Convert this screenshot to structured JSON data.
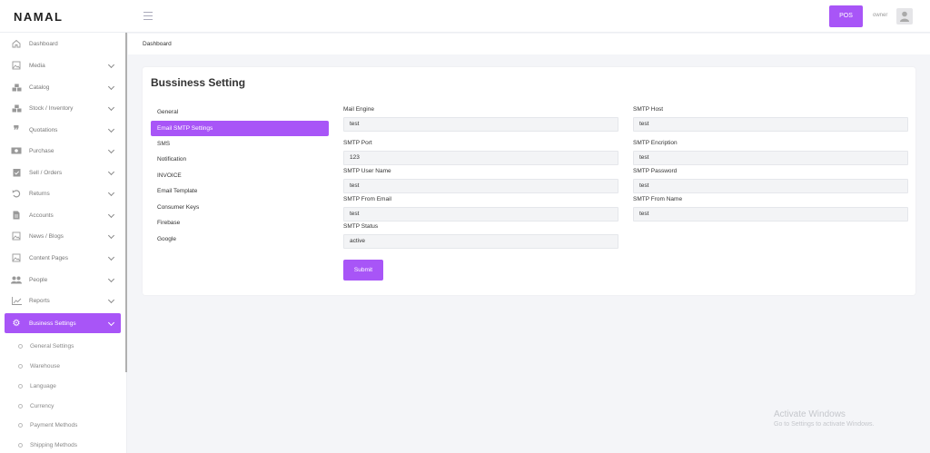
{
  "app": {
    "brand": "NAMAL"
  },
  "header": {
    "pos_label": "POS",
    "user_name": "owner"
  },
  "breadcrumb": "Dashboard",
  "sidebar": {
    "items": [
      {
        "label": "Dashboard",
        "icon": "home-icon",
        "has_chevron": false
      },
      {
        "label": "Media",
        "icon": "image-icon",
        "has_chevron": true
      },
      {
        "label": "Catalog",
        "icon": "boxes-icon",
        "has_chevron": true
      },
      {
        "label": "Stock / Inventory",
        "icon": "boxes-icon",
        "has_chevron": true
      },
      {
        "label": "Quotations",
        "icon": "quote-icon",
        "has_chevron": true
      },
      {
        "label": "Purchase",
        "icon": "money-icon",
        "has_chevron": true
      },
      {
        "label": "Sell / Orders",
        "icon": "clipboard-check-icon",
        "has_chevron": true
      },
      {
        "label": "Returns",
        "icon": "undo-icon",
        "has_chevron": true
      },
      {
        "label": "Accounts",
        "icon": "file-icon",
        "has_chevron": true
      },
      {
        "label": "News / Blogs",
        "icon": "image-icon",
        "has_chevron": true
      },
      {
        "label": "Content Pages",
        "icon": "image-icon",
        "has_chevron": true
      },
      {
        "label": "People",
        "icon": "users-icon",
        "has_chevron": true
      },
      {
        "label": "Reports",
        "icon": "chart-icon",
        "has_chevron": true
      },
      {
        "label": "Business Settings",
        "icon": "cogs-icon",
        "has_chevron": true,
        "active": true
      }
    ],
    "sub_items": [
      "General Settings",
      "Warehouse",
      "Language",
      "Currency",
      "Payment Methods",
      "Shipping Methods"
    ]
  },
  "card": {
    "title": "Bussiness Setting",
    "tabs": [
      "General",
      "Email SMTP Settings",
      "SMS",
      "Notification",
      "INVOICE",
      "Email Template",
      "Consumer Keys",
      "Firebase",
      "Google"
    ],
    "active_tab": "Email SMTP Settings",
    "fields": {
      "mail_engine": {
        "label": "Mail Engine",
        "value": "test"
      },
      "smtp_host": {
        "label": "SMTP Host",
        "value": "test"
      },
      "smtp_port": {
        "label": "SMTP Port",
        "value": "123"
      },
      "smtp_encription": {
        "label": "SMTP Encription",
        "value": "test"
      },
      "smtp_user_name": {
        "label": "SMTP User Name",
        "value": "test"
      },
      "smtp_password": {
        "label": "SMTP Password",
        "value": "test"
      },
      "smtp_from_email": {
        "label": "SMTP From Email",
        "value": "test"
      },
      "smtp_from_name": {
        "label": "SMTP From Name",
        "value": "test"
      },
      "smtp_status": {
        "label": "SMTP Status",
        "value": "active"
      }
    },
    "submit_label": "Submit"
  },
  "watermark": {
    "title": "Activate Windows",
    "subtitle": "Go to Settings to activate Windows."
  },
  "colors": {
    "accent": "#a855f7",
    "background": "#f4f5f8"
  }
}
